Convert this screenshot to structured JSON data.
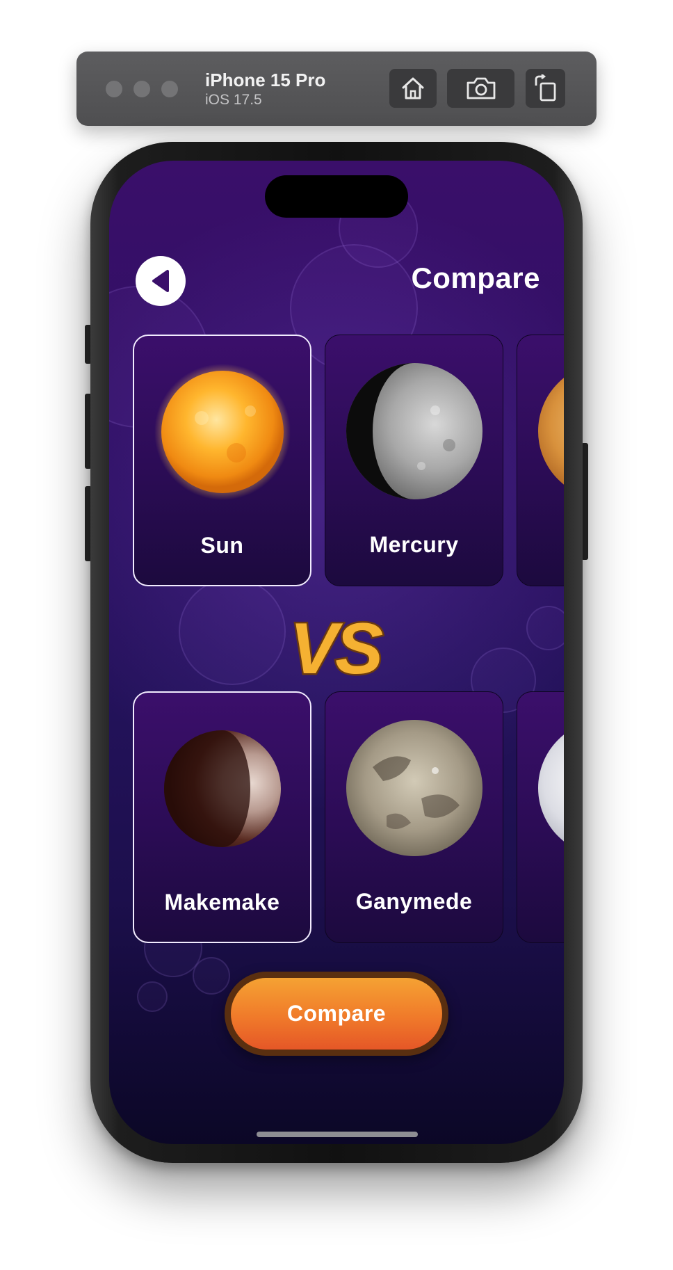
{
  "simulator": {
    "device_name": "iPhone 15 Pro",
    "os_version": "iOS 17.5",
    "toolbar_icons": [
      "home-icon",
      "screenshot-icon",
      "rotate-icon"
    ]
  },
  "screen": {
    "title": "Compare",
    "back_icon": "back-arrow-icon",
    "vs_text": "VS",
    "compare_button": "Compare"
  },
  "top_row": {
    "selected": "Sun",
    "items": [
      {
        "label": "Sun",
        "icon": "sun-icon"
      },
      {
        "label": "Mercury",
        "icon": "mercury-icon"
      },
      {
        "label": "",
        "icon": "venus-icon"
      }
    ]
  },
  "bottom_row": {
    "selected": "Makemake",
    "items": [
      {
        "label": "Makemake",
        "icon": "makemake-icon"
      },
      {
        "label": "Ganymede",
        "icon": "ganymede-icon"
      },
      {
        "label": "",
        "icon": "moon-icon"
      }
    ]
  },
  "colors": {
    "accent_orange": "#f07a2a",
    "vs_gold": "#f5b132",
    "background_purple": "#2c1062"
  }
}
